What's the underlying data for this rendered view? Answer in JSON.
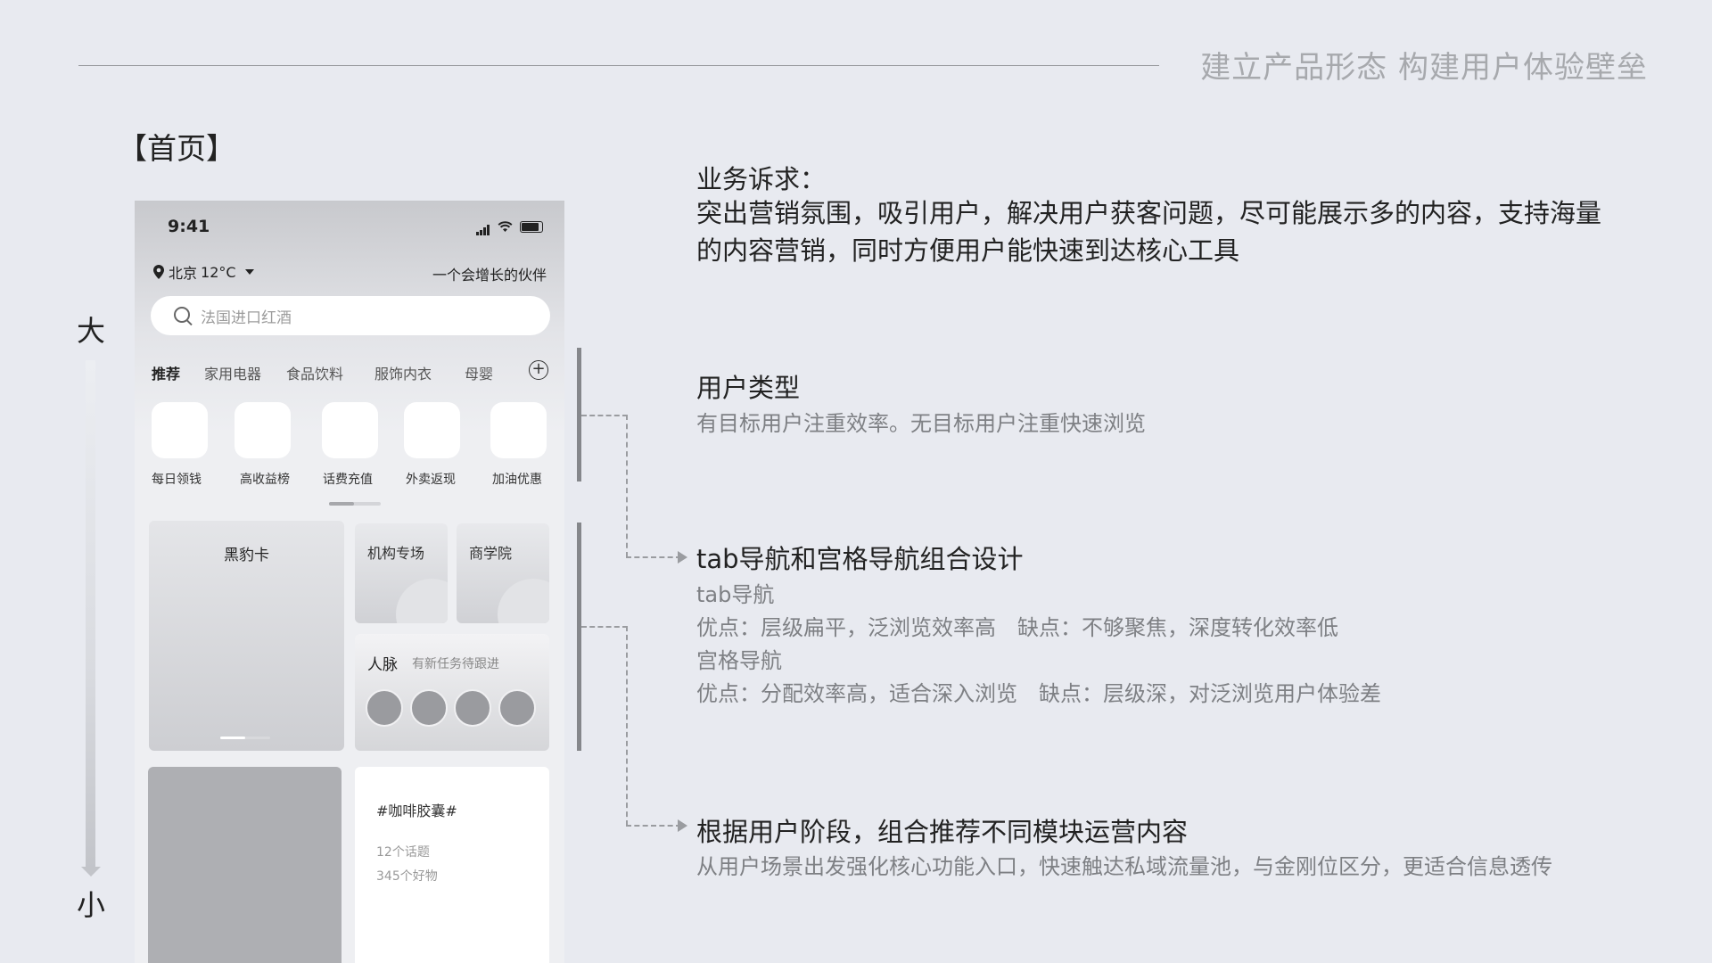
{
  "header": {
    "title": "建立产品形态 构建用户体验壁垒",
    "section_title": "【首页】"
  },
  "scale": {
    "big": "大",
    "small": "小"
  },
  "phone": {
    "status": {
      "time": "9:41"
    },
    "location": {
      "city": "北京",
      "temp": "12°C"
    },
    "slogan": "一个会增长的伙伴",
    "search": {
      "placeholder": "法国进口红酒"
    },
    "tabs": [
      {
        "label": "推荐",
        "active": true
      },
      {
        "label": "家用电器"
      },
      {
        "label": "食品饮料"
      },
      {
        "label": "服饰内衣"
      },
      {
        "label": "母婴"
      }
    ],
    "grid": [
      {
        "label": "每日领钱"
      },
      {
        "label": "高收益榜"
      },
      {
        "label": "话费充值"
      },
      {
        "label": "外卖返现"
      },
      {
        "label": "加油优惠"
      }
    ],
    "cards": {
      "heibao": "黑豹卡",
      "jigou": "机构专场",
      "shangxueyuan": "商学院",
      "renmai": {
        "title": "人脉",
        "subtitle": "有新任务待跟进"
      },
      "topic": {
        "title": "#咖啡胶囊#",
        "line1": "12个话题",
        "line2": "345个好物"
      }
    }
  },
  "annotations": {
    "business": {
      "title": "业务诉求：",
      "line1": "突出营销氛围，吸引用户，解决用户获客问题，尽可能展示多的内容，支持海量",
      "line2": "的内容营销，同时方便用户能快速到达核心工具"
    },
    "user_type": {
      "title": "用户类型",
      "body": "有目标用户注重效率。无目标用户注重快速浏览"
    },
    "nav": {
      "title": "tab导航和宫格导航组合设计",
      "tab_nav": "tab导航",
      "tab_pros": "优点：层级扁平，泛浏览效率高　缺点：不够聚焦，深度转化效率低",
      "grid_nav": "宫格导航",
      "grid_pros": "优点：分配效率高，适合深入浏览　缺点：层级深，对泛浏览用户体验差"
    },
    "stage": {
      "title": "根据用户阶段，组合推荐不同模块运营内容",
      "body": "从用户场景出发强化核心功能入口，快速触达私域流量池，与金刚位区分，更适合信息透传"
    }
  }
}
